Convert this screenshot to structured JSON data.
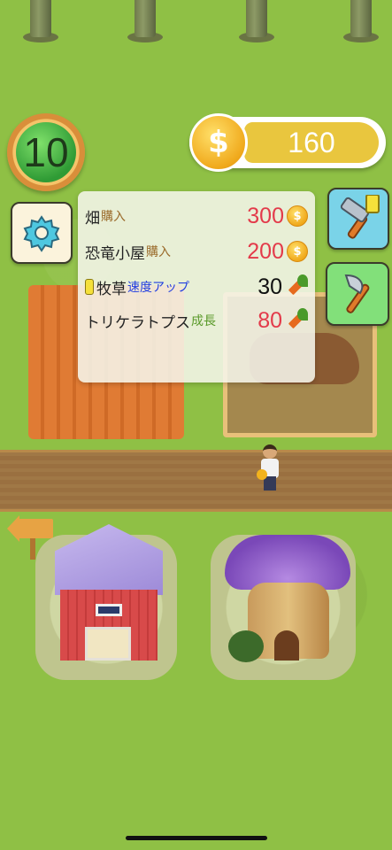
{
  "hud": {
    "level": "10",
    "coins": "160"
  },
  "panel": {
    "items": [
      {
        "name": "畑",
        "action": "購入",
        "price": "300",
        "currency": "coin",
        "action_color": "#9a6a2a",
        "price_color": "#e33a4a"
      },
      {
        "name": "恐竜小屋",
        "action": "購入",
        "price": "200",
        "currency": "coin",
        "action_color": "#9a6a2a",
        "price_color": "#e33a4a"
      },
      {
        "name": "牧草",
        "action": "速度アップ",
        "price": "30",
        "currency": "carrot",
        "action_color": "#2440e0",
        "price_color": "#111111"
      },
      {
        "name": "トリケラトプス",
        "action": "成長",
        "price": "80",
        "currency": "carrot",
        "action_color": "#5a9a2a",
        "price_color": "#e33a4a"
      }
    ]
  },
  "icons": {
    "settings": "gear-icon",
    "build": "hammer-icon",
    "demolish": "axe-icon",
    "back": "arrow-left-sign-icon"
  }
}
